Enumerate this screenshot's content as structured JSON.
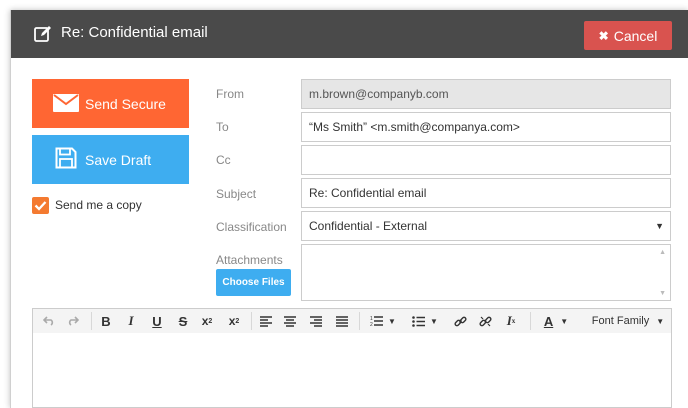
{
  "header": {
    "title": "Re: Confidential email",
    "cancel_label": "Cancel"
  },
  "actions": {
    "send_label": "Send Secure",
    "draft_label": "Save Draft",
    "copy_label": "Send me a copy",
    "copy_checked": true
  },
  "form": {
    "from_label": "From",
    "from_value": "m.brown@companyb.com",
    "to_label": "To",
    "to_value": "“Ms Smith” <m.smith@companya.com>",
    "cc_label": "Cc",
    "cc_value": "",
    "subject_label": "Subject",
    "subject_value": "Re: Confidential email",
    "classification_label": "Classification",
    "classification_value": "Confidential - External",
    "attachments_label": "Attachments",
    "choose_files_label": "Choose Files"
  },
  "toolbar": {
    "font_family_label": "Font Family"
  },
  "colors": {
    "header_bg": "#4a4a4a",
    "cancel_bg": "#d9534f",
    "send_bg": "#ff6633",
    "draft_bg": "#3eadf0",
    "checkbox": "#f47a30"
  }
}
